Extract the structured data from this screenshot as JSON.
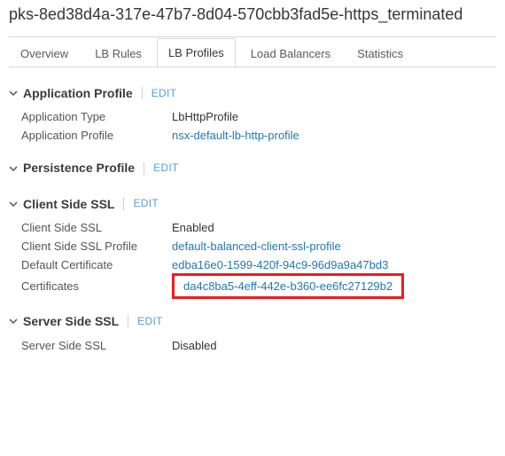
{
  "page_title": "pks-8ed38d4a-317e-47b7-8d04-570cbb3fad5e-https_terminated",
  "tabs": [
    {
      "label": "Overview",
      "active": false
    },
    {
      "label": "LB Rules",
      "active": false
    },
    {
      "label": "LB Profiles",
      "active": true
    },
    {
      "label": "Load Balancers",
      "active": false
    },
    {
      "label": "Statistics",
      "active": false
    }
  ],
  "edit_label": "EDIT",
  "sections": {
    "app": {
      "title": "Application Profile",
      "rows": [
        {
          "key": "Application Type",
          "value": "LbHttpProfile",
          "link": false
        },
        {
          "key": "Application Profile",
          "value": "nsx-default-lb-http-profile",
          "link": true
        }
      ]
    },
    "pers": {
      "title": "Persistence Profile",
      "rows": []
    },
    "cssl": {
      "title": "Client Side SSL",
      "rows": [
        {
          "key": "Client Side SSL",
          "value": "Enabled",
          "link": false
        },
        {
          "key": "Client Side SSL Profile",
          "value": "default-balanced-client-ssl-profile",
          "link": true
        },
        {
          "key": "Default Certificate",
          "value": "edba16e0-1599-420f-94c9-96d9a9a47bd3",
          "link": true
        },
        {
          "key": "Certificates",
          "value": "da4c8ba5-4eff-442e-b360-ee6fc27129b2",
          "link": true,
          "highlight": true
        }
      ]
    },
    "sssl": {
      "title": "Server Side SSL",
      "rows": [
        {
          "key": "Server Side SSL",
          "value": "Disabled",
          "link": false
        }
      ]
    }
  }
}
